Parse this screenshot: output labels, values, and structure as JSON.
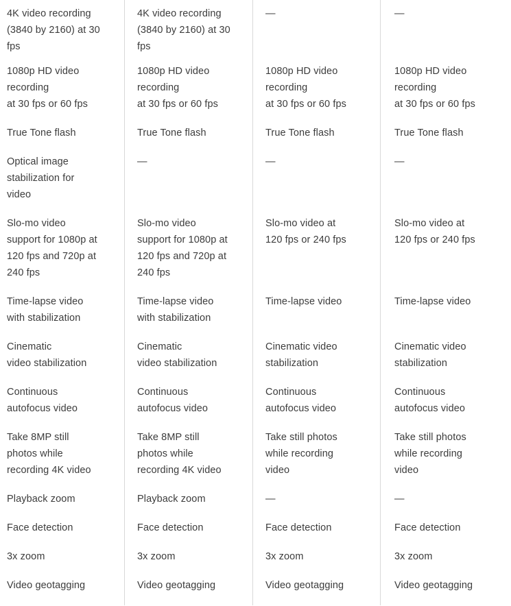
{
  "table": {
    "type": "comparison-table",
    "column_count": 4,
    "row_count": 13,
    "divider_color": "#d8d8d8",
    "text_color": "#3c3c3c",
    "background_color": "#ffffff",
    "empty_value": "—",
    "columns": [
      {
        "id": "column-1",
        "cells": [
          "4K video recording\n(3840 by 2160) at 30\nfps",
          "1080p HD video\nrecording\nat 30 fps or 60 fps",
          "True Tone flash",
          "Optical image\nstabilization for\nvideo",
          "Slo-mo video\nsupport for 1080p at\n120 fps and 720p at\n240 fps",
          "Time-lapse video\nwith stabilization",
          "Cinematic\nvideo stabilization",
          "Continuous\nautofocus video",
          "Take 8MP still\nphotos while\nrecording 4K video",
          "Playback zoom",
          "Face detection",
          "3x zoom",
          "Video geotagging"
        ]
      },
      {
        "id": "column-2",
        "cells": [
          "4K video recording\n(3840 by 2160) at 30\nfps",
          "1080p HD video\nrecording\nat 30 fps or 60 fps",
          "True Tone flash",
          "—",
          "Slo-mo video\nsupport for 1080p at\n120 fps and 720p at\n240 fps",
          "Time-lapse video\nwith stabilization",
          "Cinematic\nvideo stabilization",
          "Continuous\nautofocus video",
          "Take 8MP still\nphotos while\nrecording 4K video",
          "Playback zoom",
          "Face detection",
          "3x zoom",
          "Video geotagging"
        ]
      },
      {
        "id": "column-3",
        "cells": [
          "—",
          "1080p HD video\nrecording\nat 30 fps or 60 fps",
          "True Tone flash",
          "—",
          "Slo-mo video at\n120 fps or 240 fps",
          "Time-lapse video",
          "Cinematic video\nstabilization",
          "Continuous\nautofocus video",
          "Take still photos\nwhile recording\nvideo",
          "—",
          "Face detection",
          "3x zoom",
          "Video geotagging"
        ]
      },
      {
        "id": "column-4",
        "cells": [
          "—",
          "1080p HD video\nrecording\nat 30 fps or 60 fps",
          "True Tone flash",
          "—",
          "Slo-mo video at\n120 fps or 240 fps",
          "Time-lapse video",
          "Cinematic video\nstabilization",
          "Continuous\nautofocus video",
          "Take still photos\nwhile recording\nvideo",
          "—",
          "Face detection",
          "3x zoom",
          "Video geotagging"
        ]
      }
    ]
  }
}
